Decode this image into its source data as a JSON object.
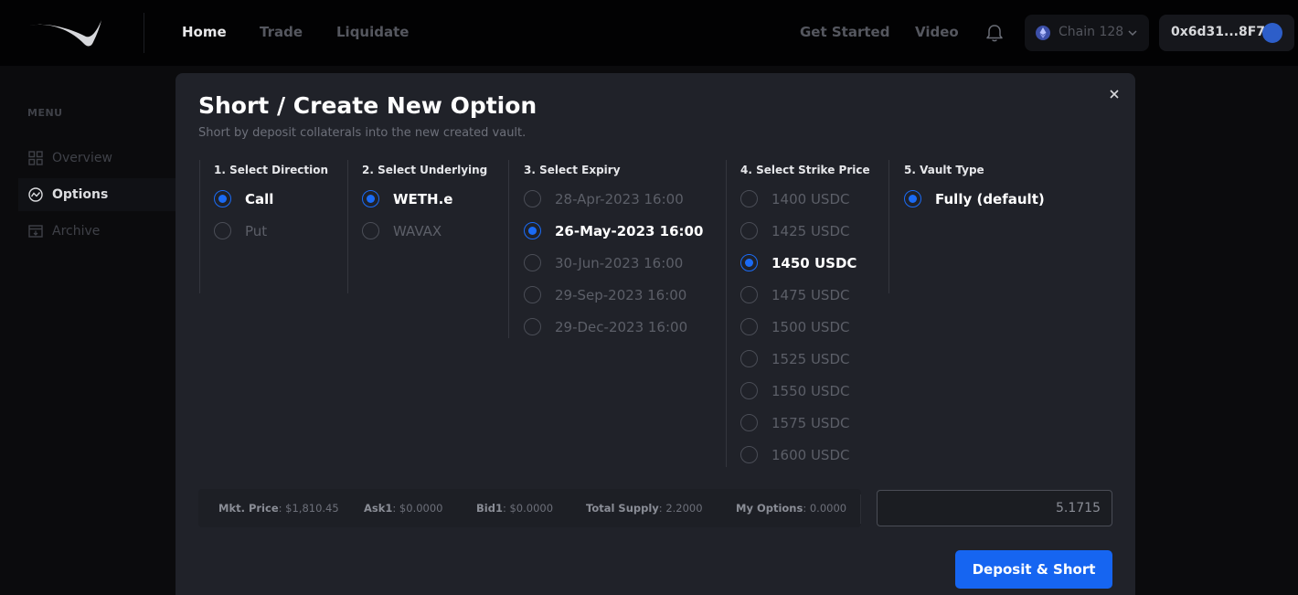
{
  "nav": {
    "links": [
      "Home",
      "Trade",
      "Liquidate"
    ],
    "right_links": [
      "Get Started",
      "Video"
    ],
    "chain_label": "Chain 128",
    "wallet_address": "0x6d31...8F7f"
  },
  "sidebar": {
    "heading": "MENU",
    "items": [
      {
        "label": "Overview",
        "icon": "overview-icon"
      },
      {
        "label": "Options",
        "icon": "options-icon"
      },
      {
        "label": "Archive",
        "icon": "archive-icon"
      }
    ]
  },
  "modal": {
    "title": "Short / Create New Option",
    "subtitle": "Short by deposit collaterals into the new created vault.",
    "columns": [
      {
        "header": "1. Select Direction",
        "options": [
          "Call",
          "Put"
        ],
        "selected": 0
      },
      {
        "header": "2. Select Underlying",
        "options": [
          "WETH.e",
          "WAVAX"
        ],
        "selected": 0
      },
      {
        "header": "3. Select Expiry",
        "options": [
          "28-Apr-2023 16:00",
          "26-May-2023 16:00",
          "30-Jun-2023 16:00",
          "29-Sep-2023 16:00",
          "29-Dec-2023 16:00"
        ],
        "selected": 1
      },
      {
        "header": "4. Select Strike Price",
        "options": [
          "1400 USDC",
          "1425 USDC",
          "1450 USDC",
          "1475 USDC",
          "1500 USDC",
          "1525 USDC",
          "1550 USDC",
          "1575 USDC",
          "1600 USDC"
        ],
        "selected": 2
      },
      {
        "header": "5. Vault Type",
        "options": [
          "Fully (default)"
        ],
        "selected": 0
      }
    ],
    "stats": {
      "mkt_price_label": "Mkt. Price",
      "mkt_price": ": $1,810.45",
      "ask_label": "Ask1",
      "ask": ": $0.0000",
      "bid_label": "Bid1",
      "bid": ": $0.0000",
      "supply_label": "Total Supply",
      "supply": ": 2.2000",
      "my_options_label": "My Options",
      "my_options": ": 0.0000"
    },
    "amount_placeholder": "5.1715",
    "submit_label": "Deposit & Short"
  },
  "colors": {
    "accent": "#1665f1",
    "background": "#0b0b0d",
    "modal": "#202229"
  }
}
